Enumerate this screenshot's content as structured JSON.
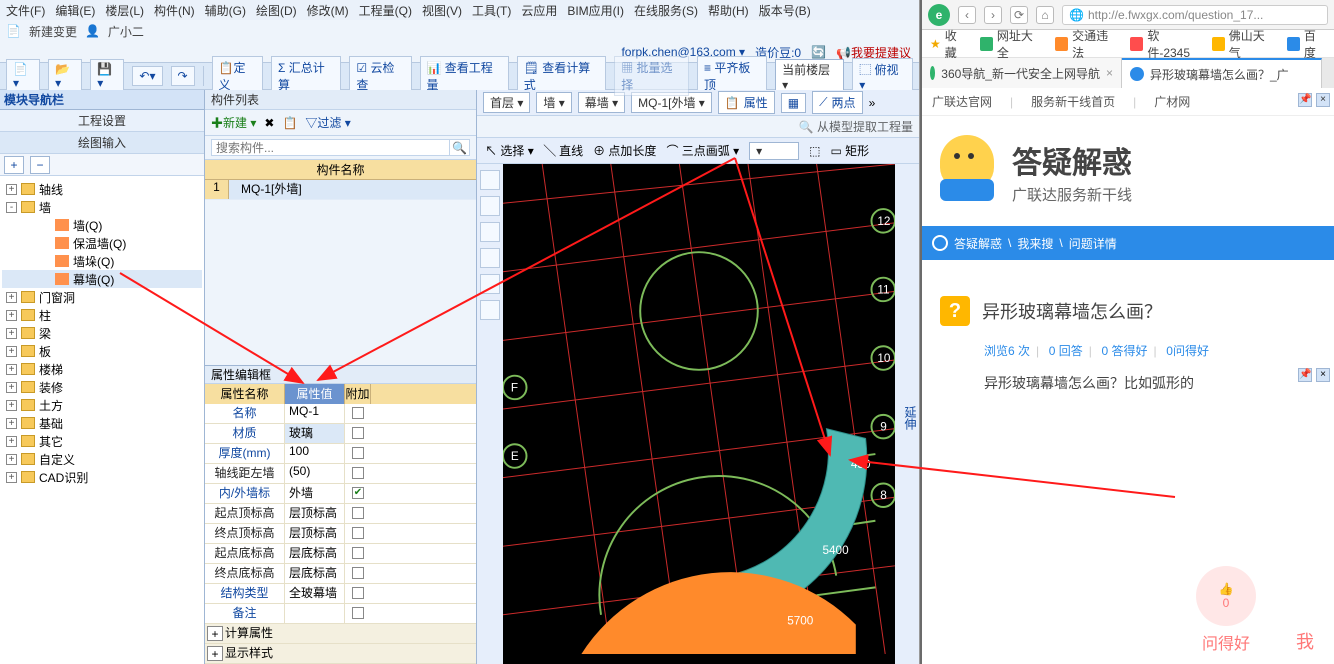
{
  "menu": [
    "文件(F)",
    "编辑(E)",
    "楼层(L)",
    "构件(N)",
    "辅助(G)",
    "绘图(D)",
    "修改(M)",
    "工程量(Q)",
    "视图(V)",
    "工具(T)",
    "云应用",
    "BIM应用(I)",
    "在线服务(S)",
    "帮助(H)",
    "版本号(B)"
  ],
  "submenu": {
    "new_change": "新建变更",
    "user": "广小二"
  },
  "userbar": {
    "email": "forpk.chen@163.com ▾",
    "credit": "造价豆:0",
    "feedback": "我要提建议"
  },
  "toolbar": {
    "define": "定义",
    "sum": "汇总计算",
    "cloud": "云检查",
    "qty": "查看工程量",
    "calc": "查看计算式",
    "batch": "批量选择",
    "align": "平齐板顶",
    "floor_current": "当前楼层",
    "view": "俯视"
  },
  "navpanel": {
    "title": "模块导航栏",
    "tab1": "工程设置",
    "tab2": "绘图输入"
  },
  "tree": {
    "items": [
      {
        "k": "axis",
        "label": "轴线",
        "exp": "+",
        "ind": 0
      },
      {
        "k": "wall",
        "label": "墙",
        "exp": "-",
        "ind": 0
      },
      {
        "k": "wall_q",
        "label": "墙(Q)",
        "ind": 2,
        "leaf": true
      },
      {
        "k": "ins_q",
        "label": "保温墙(Q)",
        "ind": 2,
        "leaf": true
      },
      {
        "k": "dk_q",
        "label": "墙垛(Q)",
        "ind": 2,
        "leaf": true
      },
      {
        "k": "mq_q",
        "label": "幕墙(Q)",
        "ind": 2,
        "leaf": true,
        "sel": true
      },
      {
        "k": "door",
        "label": "门窗洞",
        "exp": "+",
        "ind": 0
      },
      {
        "k": "col",
        "label": "柱",
        "exp": "+",
        "ind": 0
      },
      {
        "k": "beam",
        "label": "梁",
        "exp": "+",
        "ind": 0
      },
      {
        "k": "slab",
        "label": "板",
        "exp": "+",
        "ind": 0
      },
      {
        "k": "stair",
        "label": "楼梯",
        "exp": "+",
        "ind": 0
      },
      {
        "k": "deco",
        "label": "装修",
        "exp": "+",
        "ind": 0
      },
      {
        "k": "earth",
        "label": "土方",
        "exp": "+",
        "ind": 0
      },
      {
        "k": "found",
        "label": "基础",
        "exp": "+",
        "ind": 0
      },
      {
        "k": "other",
        "label": "其它",
        "exp": "+",
        "ind": 0
      },
      {
        "k": "custom",
        "label": "自定义",
        "exp": "+",
        "ind": 0
      },
      {
        "k": "cad",
        "label": "CAD识别",
        "exp": "+",
        "ind": 0
      }
    ]
  },
  "comp": {
    "title": "构件列表",
    "new": "新建",
    "filter": "过滤",
    "search_ph": "搜索构件...",
    "col": "构件名称",
    "row1_no": "1",
    "row1_val": "MQ-1[外墙]"
  },
  "prop": {
    "title": "属性编辑框",
    "h1": "属性名称",
    "h2": "属性值",
    "h3": "附加",
    "rows": [
      {
        "n": "名称",
        "v": "MQ-1",
        "c": false,
        "blue": true
      },
      {
        "n": "材质",
        "v": "玻璃",
        "c": false,
        "blue": true,
        "hl": true
      },
      {
        "n": "厚度(mm)",
        "v": "100",
        "c": false,
        "blue": true
      },
      {
        "n": "轴线距左墙",
        "v": "(50)",
        "c": false
      },
      {
        "n": "内/外墙标",
        "v": "外墙",
        "c": true,
        "blue": true
      },
      {
        "n": "起点顶标高",
        "v": "层顶标高",
        "c": false
      },
      {
        "n": "终点顶标高",
        "v": "层顶标高",
        "c": false
      },
      {
        "n": "起点底标高",
        "v": "层底标高",
        "c": false
      },
      {
        "n": "终点底标高",
        "v": "层底标高",
        "c": false
      },
      {
        "n": "结构类型",
        "v": "全玻幕墙",
        "c": false,
        "blue": true
      },
      {
        "n": "备注",
        "v": "",
        "c": false,
        "blue": true
      }
    ],
    "grp1": "计算属性",
    "grp2": "显示样式"
  },
  "canvas": {
    "floor": "首层",
    "cat": "墙",
    "sub": "幕墙",
    "comp": "MQ-1[外墙",
    "propbtn": "属性",
    "twopt": "两点",
    "extract": "从模型提取工程量",
    "sel": "选择",
    "line": "直线",
    "extlen": "点加长度",
    "arc3": "三点画弧",
    "rect": "矩形"
  },
  "viewport": {
    "labels": [
      "12",
      "11",
      "10",
      "9",
      "8"
    ],
    "dims": [
      "450",
      "5400",
      "5700"
    ],
    "axisF": "F",
    "axisE": "E"
  },
  "browser": {
    "url": "http://e.fwxgx.com/question_17...",
    "favs": {
      "star": "收藏",
      "site": "网址大全",
      "traffic": "交通违法",
      "soft": "软件-2345",
      "weather": "佛山天气",
      "baidu": "百度"
    },
    "tab1": "360导航_新一代安全上网导航",
    "tab2": "异形玻璃幕墙怎么画？_广",
    "nav": {
      "a": "广联达官网",
      "b": "服务新干线首页",
      "c": "广材网"
    },
    "hero": {
      "title": "答疑解惑",
      "sub": "广联达服务新干线"
    },
    "crumb": {
      "a": "答疑解惑",
      "b": "我来搜",
      "c": "问题详情"
    },
    "q": {
      "title": "异形玻璃幕墙怎么画？",
      "stats": {
        "views": "浏览6 次",
        "ans": "0 回答",
        "good": "0 答得好",
        "ask": "0问得好"
      },
      "desc": "异形玻璃幕墙怎么画？比如弧形的"
    },
    "actions": {
      "thumb": "👍",
      "zero": "0",
      "askgood": "问得好",
      "me": "我"
    }
  }
}
